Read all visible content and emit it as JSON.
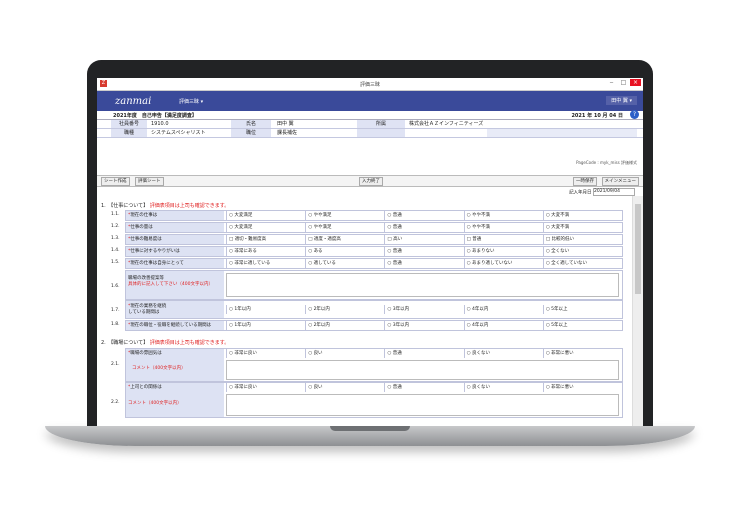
{
  "window": {
    "title": "評価三昧",
    "min": "‒",
    "max": "□",
    "close": "×"
  },
  "app": {
    "brand": "zanmai",
    "menu": "評価三昧 ▾",
    "user": "田中 翼 ▾"
  },
  "header": {
    "year_title": "2021年度　自己申告【満足度調査】",
    "date": "2021 年 10 月 04 日",
    "help": "?",
    "row1": {
      "emp_no_label": "社員番号",
      "emp_no": "1910.0",
      "name_label": "氏名",
      "name": "田中 翼",
      "company_label": "所属",
      "company": "株式会社ＡＺインフィニティーズ"
    },
    "row2": {
      "job_label": "職種",
      "job": "システムスペシャリスト",
      "post_label": "職位",
      "post": "課長補佐"
    }
  },
  "codeline": "PageCode : myk_miss 評価様式",
  "toolbar": {
    "sheet_select": "シート作成",
    "eval_sheet": "評価シート",
    "input_done": "入力終了",
    "save": "一時保存",
    "main_menu": "メインメニュー"
  },
  "entry": {
    "label": "記入年月日",
    "value": "2021/09/04"
  },
  "sections": [
    {
      "title": "1.　【仕事について】",
      "note": "評価表項目は上司も確認できます。"
    },
    {
      "title": "2.　【職場について】",
      "note": "評価表項目は上司も確認できます。"
    }
  ],
  "questions": [
    {
      "num": "1.1.",
      "label": "現在の仕事は",
      "opts": [
        "大変満足",
        "やや満足",
        "普通",
        "やや不満",
        "大変不満"
      ]
    },
    {
      "num": "1.2.",
      "label": "仕事の量は",
      "opts": [
        "大変満足",
        "やや満足",
        "普通",
        "やや不満",
        "大変不満"
      ]
    },
    {
      "num": "1.3.",
      "label": "仕事の難易度は",
      "opts": [
        "適切・難易度高",
        "適度・適度高",
        "高い",
        "普通",
        "比較的低い"
      ]
    },
    {
      "num": "1.4.",
      "label": "仕事に対するやりがいは",
      "opts": [
        "非常にある",
        "ある",
        "普通",
        "あまりない",
        "全くない"
      ]
    },
    {
      "num": "1.5.",
      "label": "現在の仕事は自身にとって",
      "opts": [
        "非常に適している",
        "適している",
        "普通",
        "あまり適していない",
        "全く適していない"
      ]
    }
  ],
  "q16": {
    "num": "1.6.",
    "label1": "職場の改善提案等",
    "label2": "具体的に記入して下さい（400文字以内）"
  },
  "q17": {
    "num": "1.7.",
    "label1": "現在の業務を継続",
    "label2": "している期間は",
    "opts": [
      "1年以内",
      "2年以内",
      "3年以内",
      "4年以内",
      "5年以上"
    ]
  },
  "q18": {
    "num": "1.8.",
    "label": "現在の職位・役職を継続している期間は",
    "opts": [
      "1年以内",
      "2年以内",
      "3年以内",
      "4年以内",
      "5年以上"
    ]
  },
  "q21": {
    "num": "2.1.",
    "label": "職場の雰囲気は",
    "comment": "コメント（400文字以内）",
    "opts": [
      "非常に良い",
      "良い",
      "普通",
      "良くない",
      "非常に悪い"
    ]
  },
  "q22": {
    "num": "2.2.",
    "label": "上司との関係は",
    "comment": "コメント（400文字以内）",
    "opts": [
      "非常に良い",
      "良い",
      "普通",
      "良くない",
      "非常に悪い"
    ]
  }
}
